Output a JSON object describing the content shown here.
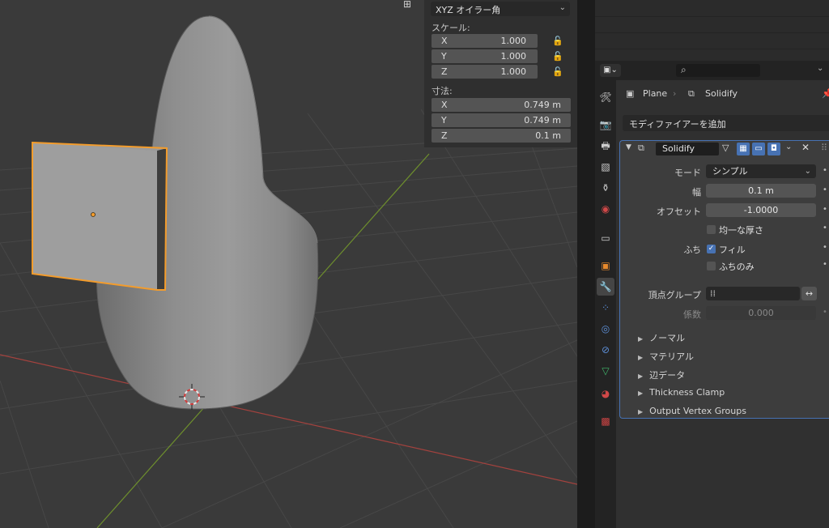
{
  "viewport": {
    "grid_icon": "grid-icon",
    "colors": {
      "x_axis": "#a3423e",
      "y_axis": "#6e8f2d",
      "selection": "#f39c2c",
      "grid": "#474747"
    }
  },
  "npanel": {
    "rotation_mode": "XYZ オイラー角",
    "scale_label": "スケール:",
    "scale": [
      {
        "axis": "X",
        "value": "1.000"
      },
      {
        "axis": "Y",
        "value": "1.000"
      },
      {
        "axis": "Z",
        "value": "1.000"
      }
    ],
    "dimensions_label": "寸法:",
    "dimensions": [
      {
        "axis": "X",
        "value": "0.749 m"
      },
      {
        "axis": "Y",
        "value": "0.749 m"
      },
      {
        "axis": "Z",
        "value": "0.1 m"
      }
    ]
  },
  "properties": {
    "breadcrumb": {
      "object": "Plane",
      "modifier": "Solidify"
    },
    "add_modifier": "モディファイアーを追加",
    "modifier": {
      "name": "Solidify",
      "mode_label": "モード",
      "mode_value": "シンプル",
      "width_label": "幅",
      "width_value": "0.1 m",
      "offset_label": "オフセット",
      "offset_value": "-1.0000",
      "even_thickness": "均一な厚さ",
      "rim_label": "ふち",
      "fill": "フィル",
      "rim_only": "ふちのみ",
      "vgroup_label": "頂点グループ",
      "factor_label": "係数",
      "factor_value": "0.000",
      "subpanels": [
        "ノーマル",
        "マテリアル",
        "辺データ",
        "Thickness Clamp",
        "Output Vertex Groups"
      ]
    },
    "accent": "#4772b3"
  }
}
